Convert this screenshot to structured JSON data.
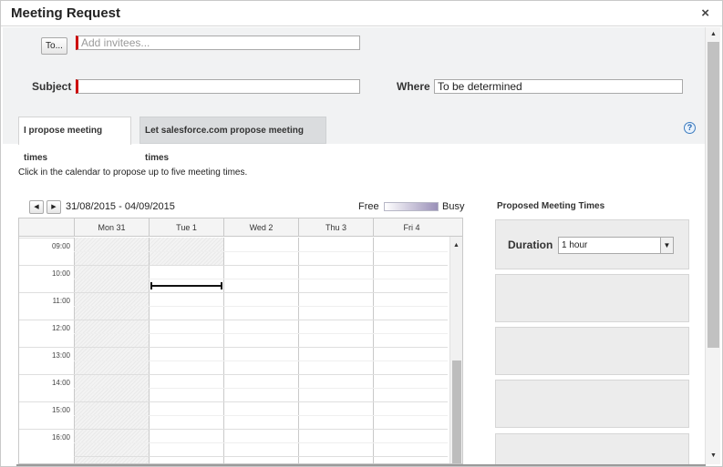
{
  "dialog": {
    "title": "Meeting Request",
    "close_glyph": "×"
  },
  "form": {
    "to_button": "To...",
    "invitees_placeholder": "Add invitees...",
    "subject_label": "Subject",
    "subject_value": "",
    "where_label": "Where",
    "where_value": "To be determined"
  },
  "tabs": [
    {
      "label": "I propose meeting times",
      "active": true
    },
    {
      "label": "Let salesforce.com propose meeting times",
      "active": false
    }
  ],
  "help_glyph": "?",
  "instructions": "Click in the calendar to propose up to five meeting times.",
  "calendar": {
    "prev_glyph": "◀",
    "next_glyph": "▶",
    "date_range": "31/08/2015 - 04/09/2015",
    "legend_free": "Free",
    "legend_busy": "Busy",
    "days": [
      "Mon 31",
      "Tue 1",
      "Wed 2",
      "Thu 3",
      "Fri 4"
    ],
    "times": [
      "09:00",
      "10:00",
      "11:00",
      "12:00",
      "13:00",
      "14:00",
      "15:00",
      "16:00"
    ],
    "scroll_up_glyph": "▲"
  },
  "proposed": {
    "title": "Proposed Meeting Times",
    "duration_label": "Duration",
    "duration_value": "1 hour",
    "dropdown_glyph": "▼"
  },
  "scrollbar": {
    "up_glyph": "▲",
    "down_glyph": "▼"
  }
}
